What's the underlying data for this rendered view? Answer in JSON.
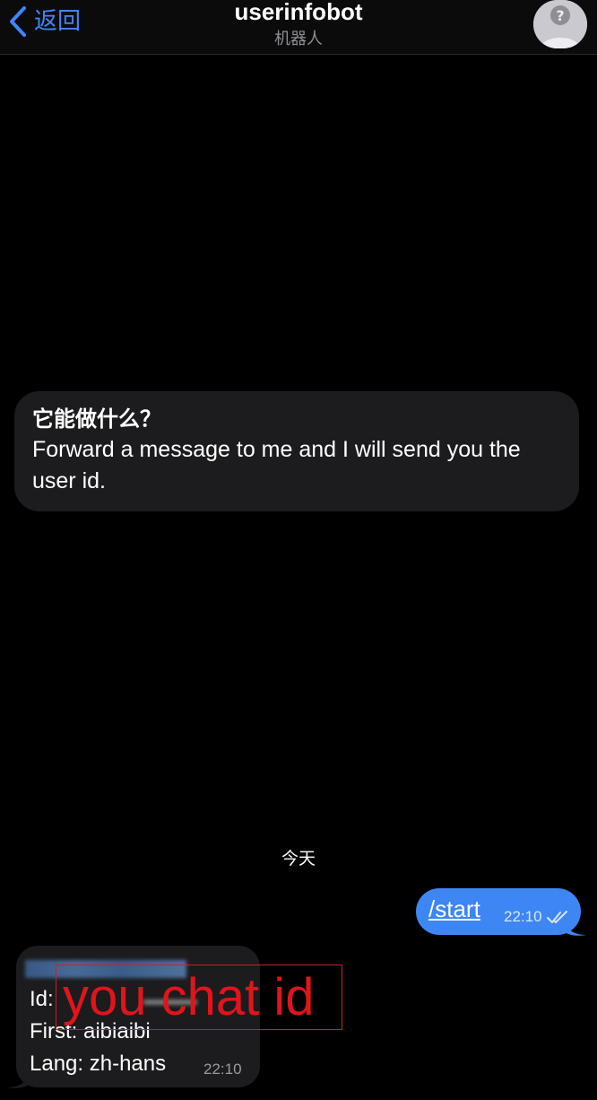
{
  "header": {
    "back_label": "返回",
    "title": "userinfobot",
    "subtitle": "机器人",
    "avatar_icon": "unknown-user-avatar-icon"
  },
  "info_card": {
    "title": "它能做什么？",
    "text": "Forward a message to me and I will send you the user id."
  },
  "date_separator": "今天",
  "outgoing_message": {
    "text": "/start",
    "time": "22:10",
    "status_icon": "double-check-icon"
  },
  "reply_message": {
    "id_line": "Id:",
    "first_line": "First: aibiaibi",
    "lang_line": "Lang: zh-hans",
    "time": "22:10"
  },
  "annotation": {
    "text": "you chat id",
    "color": "#e1141c"
  },
  "colors": {
    "accent": "#3f86ff",
    "outgoing_bubble": "#3d86f4",
    "incoming_bubble": "#1c1c1e",
    "background": "#000000"
  }
}
